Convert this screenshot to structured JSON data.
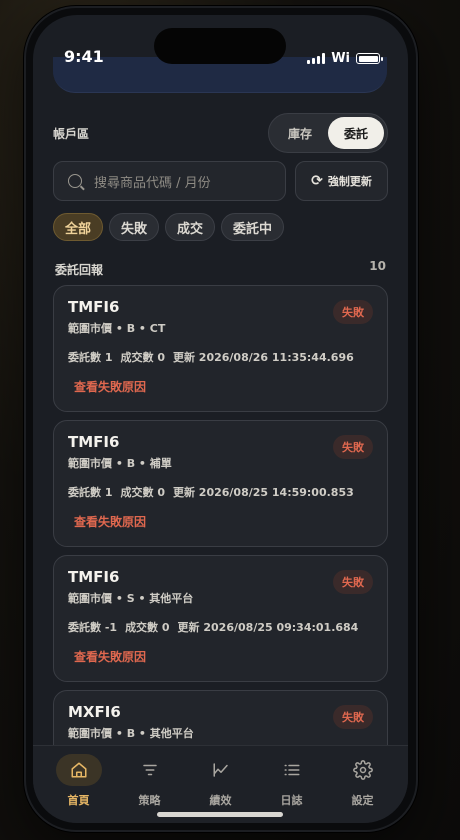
{
  "status": {
    "time": "9:41",
    "wifi": "Wi"
  },
  "account": {
    "title": "帳戶區",
    "segments": [
      "庫存",
      "委託"
    ],
    "active_segment": "委託"
  },
  "search": {
    "placeholder": "搜尋商品代碼 / 月份"
  },
  "refresh": {
    "label": "強制更新"
  },
  "filters": [
    "全部",
    "失敗",
    "成交",
    "委託中"
  ],
  "active_filter": "全部",
  "list": {
    "title": "委託回報",
    "count": "10"
  },
  "orders": [
    {
      "symbol": "TMFI6",
      "sub": "範圍市價 • B • CT",
      "qty": "委託數 1",
      "filled": "成交數 0",
      "updated": "更新 2026/08/26 11:35:44.696",
      "status": "失敗",
      "link": "查看失敗原因"
    },
    {
      "symbol": "TMFI6",
      "sub": "範圍市價 • B • 補單",
      "qty": "委託數 1",
      "filled": "成交數 0",
      "updated": "更新 2026/08/25 14:59:00.853",
      "status": "失敗",
      "link": "查看失敗原因"
    },
    {
      "symbol": "TMFI6",
      "sub": "範圍市價 • S • 其他平台",
      "qty": "委託數 -1",
      "filled": "成交數 0",
      "updated": "更新 2026/08/25 09:34:01.684",
      "status": "失敗",
      "link": "查看失敗原因"
    },
    {
      "symbol": "MXFI6",
      "sub": "範圍市價 • B • 其他平台",
      "qty": "",
      "filled": "",
      "updated": "",
      "status": "失敗",
      "link": ""
    }
  ],
  "tabbar": {
    "items": [
      {
        "label": "首頁",
        "icon": "home-icon"
      },
      {
        "label": "策略",
        "icon": "filter-icon"
      },
      {
        "label": "績效",
        "icon": "chart-line-icon"
      },
      {
        "label": "日誌",
        "icon": "list-icon"
      },
      {
        "label": "設定",
        "icon": "gear-icon"
      }
    ],
    "active": "首頁"
  },
  "colors": {
    "accent": "#e7b765",
    "danger": "#e0684f",
    "background": "#1b1e24"
  }
}
